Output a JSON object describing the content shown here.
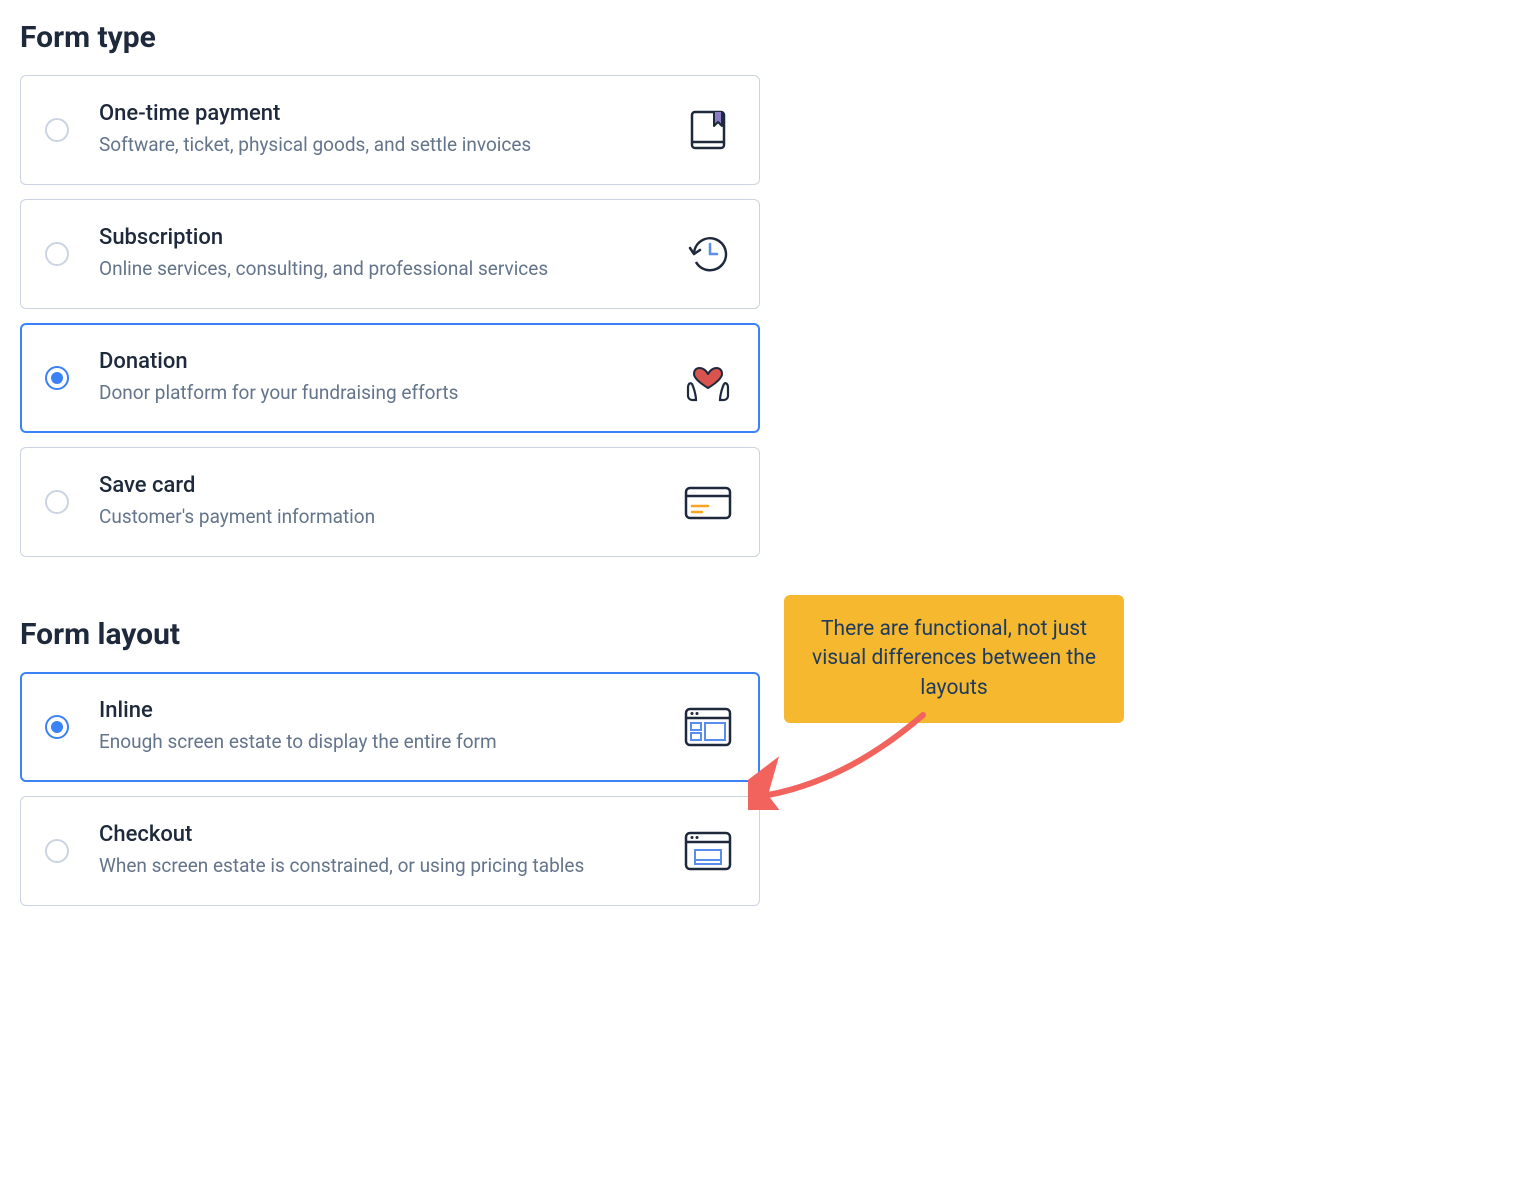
{
  "sections": {
    "formType": {
      "title": "Form type",
      "options": [
        {
          "id": "one-time",
          "title": "One-time payment",
          "description": "Software, ticket, physical goods, and settle invoices",
          "selected": false,
          "icon": "book"
        },
        {
          "id": "subscription",
          "title": "Subscription",
          "description": "Online services, consulting, and professional services",
          "selected": false,
          "icon": "clock"
        },
        {
          "id": "donation",
          "title": "Donation",
          "description": "Donor platform for your fundraising efforts",
          "selected": true,
          "icon": "heart-hands"
        },
        {
          "id": "save-card",
          "title": "Save card",
          "description": "Customer's payment information",
          "selected": false,
          "icon": "credit-card"
        }
      ]
    },
    "formLayout": {
      "title": "Form layout",
      "options": [
        {
          "id": "inline",
          "title": "Inline",
          "description": "Enough screen estate to display the entire form",
          "selected": true,
          "icon": "layout-inline"
        },
        {
          "id": "checkout",
          "title": "Checkout",
          "description": "When screen estate is constrained, or using pricing tables",
          "selected": false,
          "icon": "layout-checkout"
        }
      ]
    }
  },
  "callout": {
    "text": "There are functional, not just visual differences between the layouts"
  },
  "colors": {
    "primary": "#3b82f6",
    "textDark": "#1e293b",
    "textMuted": "#64748b",
    "border": "#cbd5e1",
    "calloutBg": "#f5b82e",
    "calloutText": "#1e3a5f",
    "arrowRed": "#f1635c"
  }
}
